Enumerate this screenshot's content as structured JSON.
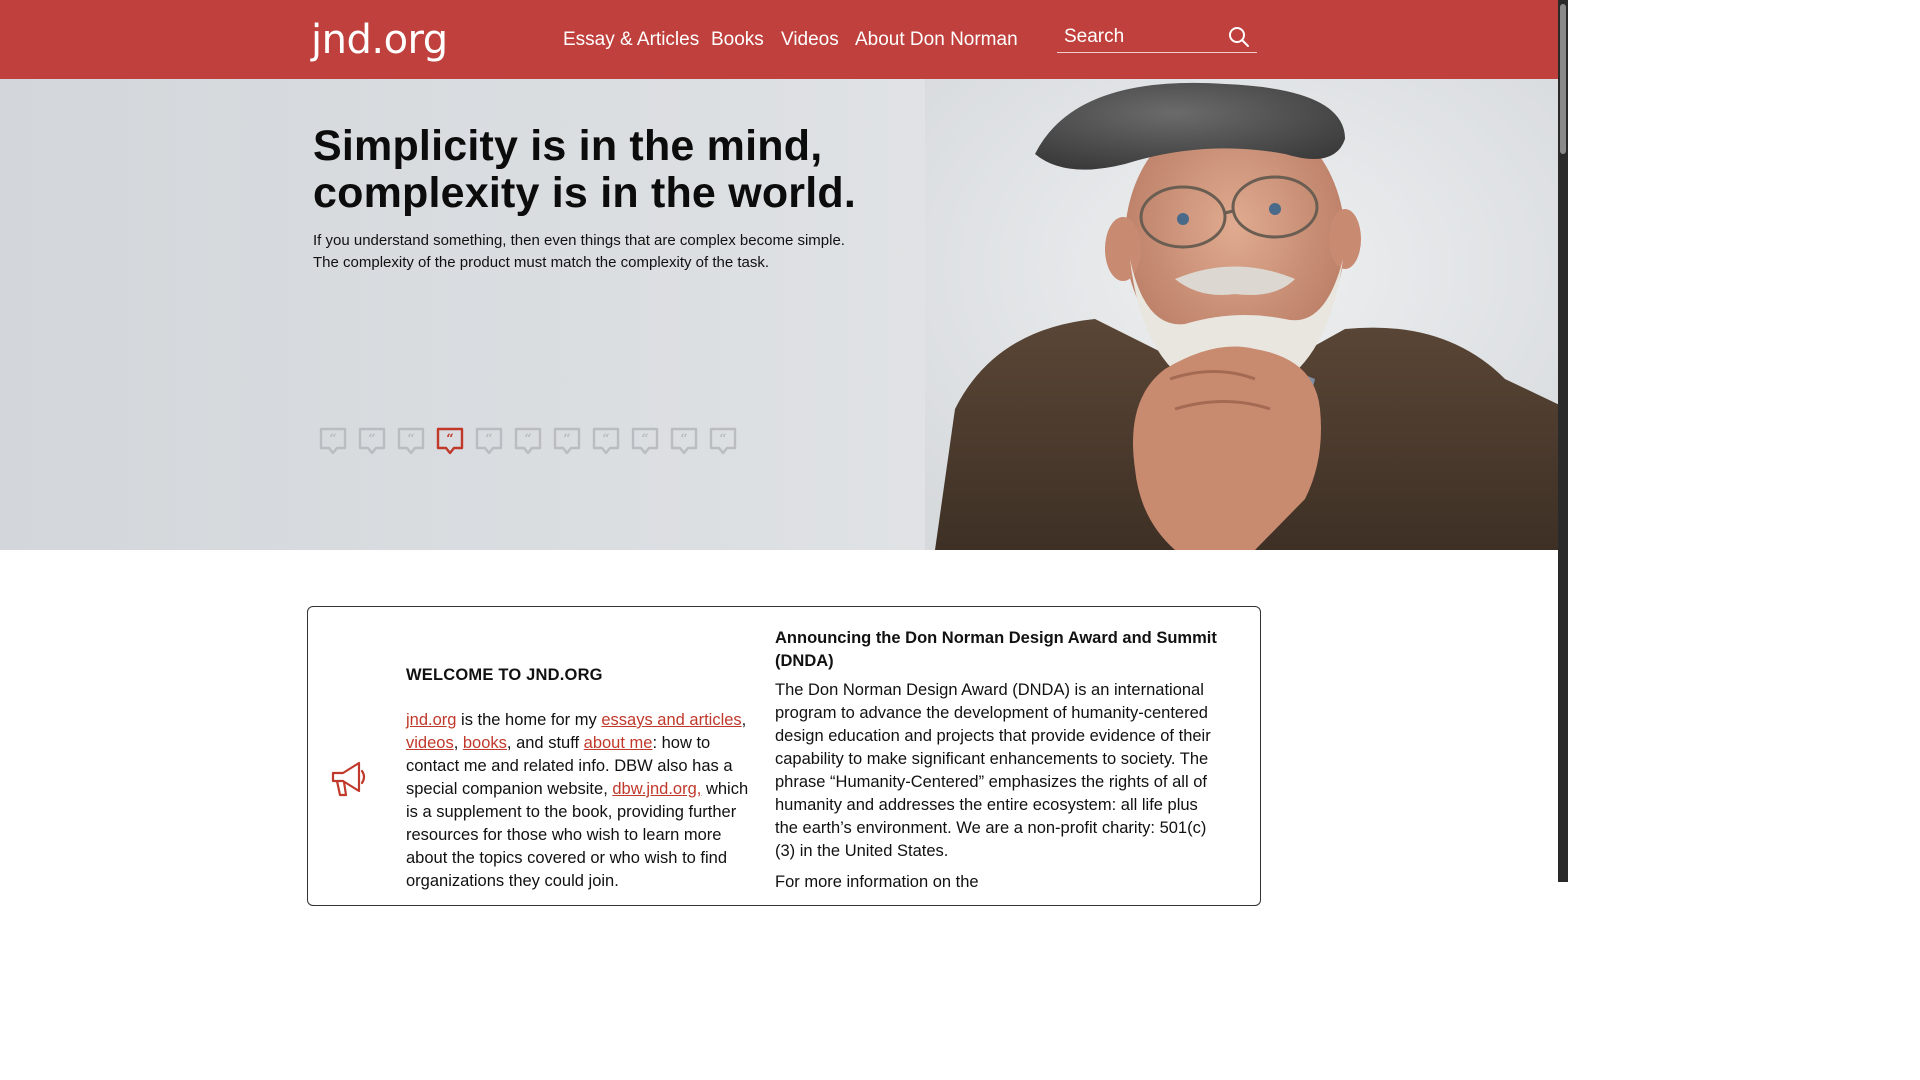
{
  "header": {
    "logo": "jnd.org",
    "nav": [
      {
        "label": "Essay & Articles"
      },
      {
        "label": "Books"
      },
      {
        "label": "Videos"
      },
      {
        "label": "About Don Norman"
      }
    ],
    "search": {
      "placeholder": "Search",
      "value": "",
      "icon": "search-icon"
    }
  },
  "hero": {
    "title_line1": "Simplicity is in the mind,",
    "title_line2": "complexity is in the world.",
    "subtitle_line1": "If you understand something, then even things that are complex become simple.",
    "subtitle_line2": "The complexity of the product must match the complexity of the task.",
    "quote_count": 11,
    "active_quote": 4,
    "active_color": "#c0392b",
    "inactive_color": "#b9bcc0"
  },
  "welcome": {
    "title": "WELCOME TO JND.ORG",
    "link_site": "jnd.org",
    "text1": " is the home for my ",
    "link_essays": "essays and articles",
    "text2": ",",
    "link_videos": "videos",
    "text3": ", ",
    "link_books": "books",
    "text4": ", and stuff ",
    "link_about": "about me",
    "text5": ": how to contact me and related info. DBW also has a special companion website, ",
    "link_dbw": "dbw.jnd.org,",
    "text6": " which is a supplement to the book, providing further resources for those who wish to learn more about the topics covered or who wish to find organizations they could join."
  },
  "dnda": {
    "title": "Announcing the Don Norman Design Award and Summit (DNDA)",
    "body": "The Don Norman Design Award (DNDA) is an international program to advance the development of humanity-centered design education and projects that provide evidence of their capability to make significant enhancements to society. The phrase “Humanity-Centered” emphasizes the rights of all of humanity and addresses the entire ecosystem: all life plus the earth’s environment. We are a non-profit charity: 501(c)(3) in the United States.",
    "more": "For more information on the"
  },
  "colors": {
    "brand": "#bf403c",
    "link": "#c0392b",
    "hero_bg": "#dcdfe2"
  }
}
